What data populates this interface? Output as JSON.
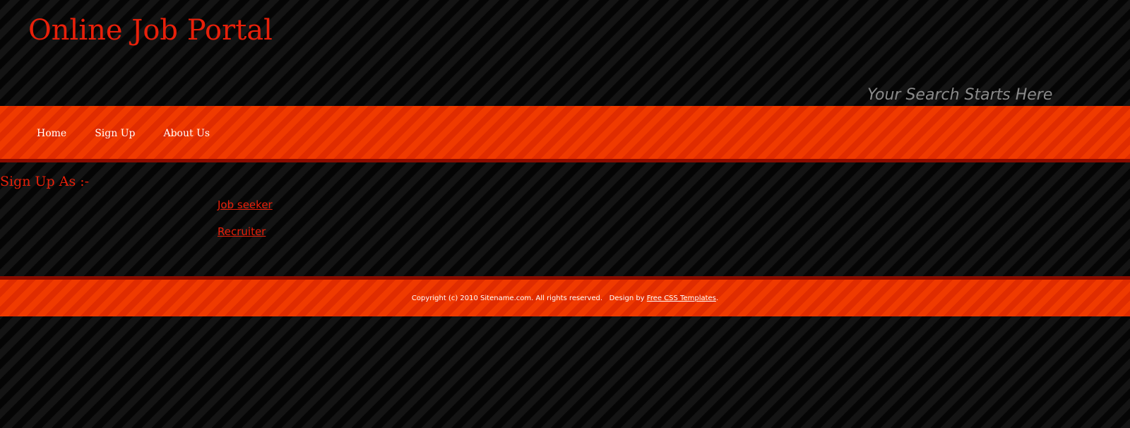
{
  "header": {
    "site_title": "Online Job Portal",
    "tagline": "Your Search Starts Here"
  },
  "menu": {
    "items": [
      {
        "label": "Home"
      },
      {
        "label": "Sign Up"
      },
      {
        "label": "About Us"
      }
    ]
  },
  "main": {
    "heading": "Sign Up As :-",
    "options": [
      {
        "label": "Job seeker"
      },
      {
        "label": "Recruiter"
      }
    ]
  },
  "footer": {
    "copyright": "Copyright (c) 2010 Sitename.com. All rights reserved.",
    "design_by": "Design by",
    "design_link": "Free CSS Templates",
    "end": "."
  },
  "colors": {
    "accent": "#e8200a",
    "bar": "#ee3200",
    "bar_border": "#8a0c00",
    "background": "#000000"
  }
}
